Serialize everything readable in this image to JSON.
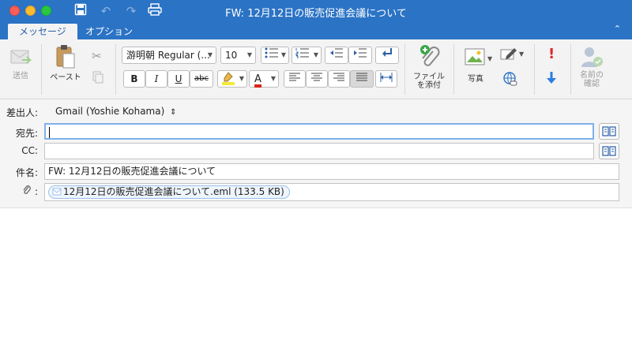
{
  "window": {
    "title": "FW: 12月12日の販売促進会議について"
  },
  "tabs": [
    {
      "label": "メッセージ",
      "active": true
    },
    {
      "label": "オプション",
      "active": false
    }
  ],
  "ribbon": {
    "send_label": "送信",
    "paste_label": "ペースト",
    "font_name": "游明朝 Regular (...",
    "font_size": "10",
    "attach_label_1": "ファイル",
    "attach_label_2": "を添付",
    "photo_label": "写真",
    "check_names_label_1": "名前の",
    "check_names_label_2": "確認",
    "bold": "B",
    "italic": "I",
    "underline": "U",
    "strikethrough": "abc",
    "font_color": "A"
  },
  "form": {
    "from_label": "差出人:",
    "from_value": "Gmail (Yoshie Kohama)",
    "to_label": "宛先:",
    "to_value": "",
    "cc_label": "CC:",
    "cc_value": "",
    "subject_label": "件名:",
    "subject_value": "FW: 12月12日の販売促進会議について",
    "attachment_label": ":",
    "attachment_value": "12月12日の販売促進会議について.eml (133.5 KB)"
  },
  "colors": {
    "titlebar": "#2b73c5",
    "ribbon_bg": "#f3f3f3",
    "focus_border": "#7fb1ea",
    "highlight_yellow": "#f5e93a",
    "font_red": "#d8261c",
    "importance_red": "#e0262b",
    "low_importance_blue": "#2a7de1"
  }
}
